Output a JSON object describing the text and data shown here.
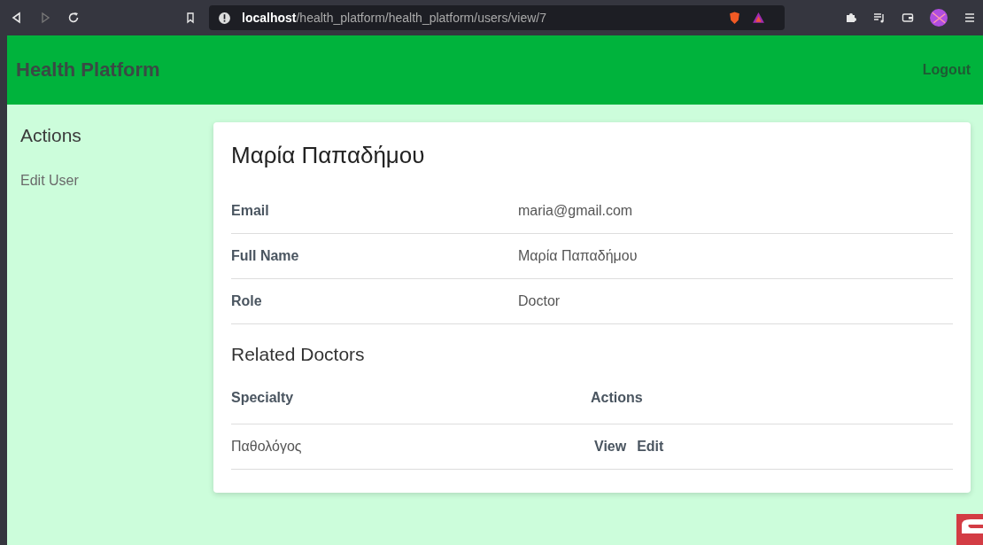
{
  "browser": {
    "url_host": "localhost",
    "url_path": "/health_platform/health_platform/users/view/7"
  },
  "header": {
    "brand": "Health Platform",
    "logout": "Logout"
  },
  "sidebar": {
    "heading": "Actions",
    "items": [
      {
        "label": "Edit User"
      }
    ]
  },
  "user": {
    "title": "Μαρία Παπαδήμου",
    "fields": [
      {
        "label": "Email",
        "value": "maria@gmail.com"
      },
      {
        "label": "Full Name",
        "value": "Μαρία Παπαδήμου"
      },
      {
        "label": "Role",
        "value": "Doctor"
      }
    ]
  },
  "related": {
    "heading": "Related Doctors",
    "columns": [
      "Specialty",
      "Actions"
    ],
    "rows": [
      {
        "specialty": "Παθολόγος",
        "actions": [
          "View",
          "Edit"
        ]
      }
    ]
  }
}
